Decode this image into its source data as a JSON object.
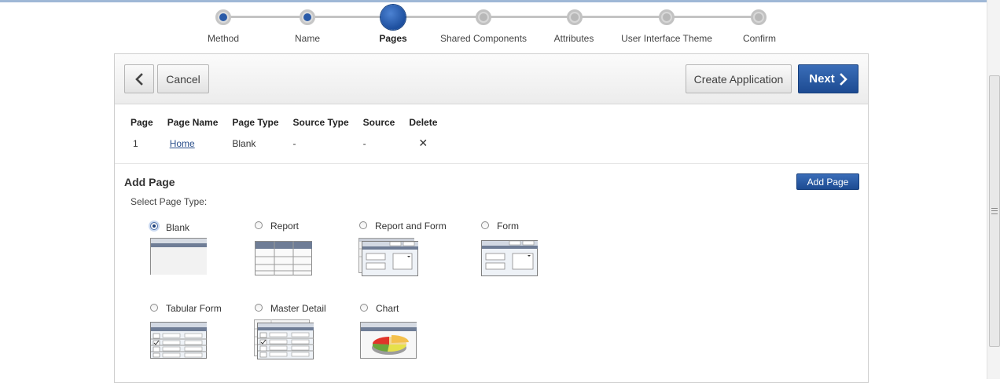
{
  "wizard": {
    "steps": [
      {
        "label": "Method",
        "state": "done"
      },
      {
        "label": "Name",
        "state": "done"
      },
      {
        "label": "Pages",
        "state": "current"
      },
      {
        "label": "Shared Components",
        "state": "todo"
      },
      {
        "label": "Attributes",
        "state": "todo"
      },
      {
        "label": "User Interface Theme",
        "state": "todo"
      },
      {
        "label": "Confirm",
        "state": "todo"
      }
    ]
  },
  "toolbar": {
    "cancel_label": "Cancel",
    "create_label": "Create Application",
    "next_label": "Next"
  },
  "pages_table": {
    "headers": [
      "Page",
      "Page Name",
      "Page Type",
      "Source Type",
      "Source",
      "Delete"
    ],
    "rows": [
      {
        "page": "1",
        "page_name": "Home",
        "page_type": "Blank",
        "source_type": "-",
        "source": "-",
        "delete": "✕"
      }
    ]
  },
  "add_page": {
    "title": "Add Page",
    "button_label": "Add Page",
    "select_label": "Select Page Type:",
    "options": [
      {
        "label": "Blank",
        "checked": true,
        "thumb": "blank"
      },
      {
        "label": "Report",
        "checked": false,
        "thumb": "report"
      },
      {
        "label": "Report and Form",
        "checked": false,
        "thumb": "report-form"
      },
      {
        "label": "Form",
        "checked": false,
        "thumb": "form"
      },
      {
        "label": "Tabular Form",
        "checked": false,
        "thumb": "tabular-form"
      },
      {
        "label": "Master Detail",
        "checked": false,
        "thumb": "master-detail"
      },
      {
        "label": "Chart",
        "checked": false,
        "thumb": "chart"
      }
    ]
  },
  "colors": {
    "accent": "#1d4b92",
    "link": "#2b4f8b"
  }
}
